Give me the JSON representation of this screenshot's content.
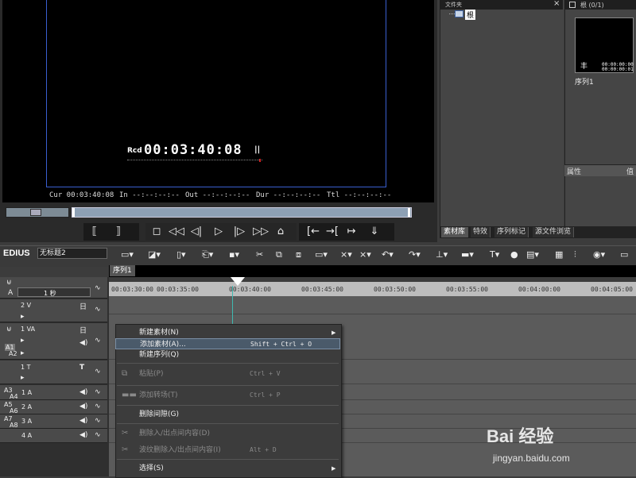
{
  "preview": {
    "rcd_label": "Rcd",
    "record_timecode": "00:03:40:08",
    "pause_indicator": "||",
    "readouts": {
      "cur": "Cur 00:03:40:08",
      "in": "In --:--:--:--",
      "out": "Out --:--:--:--",
      "dur": "Dur --:--:--:--",
      "ttl": "Ttl --:--:--:--"
    }
  },
  "bin": {
    "title": "文件夹",
    "close_icon": "×",
    "root_folder": "根",
    "tabs": [
      "素材库",
      "特效",
      "序列标记",
      "源文件浏览"
    ]
  },
  "clip_panel": {
    "count": "根 (0/1)",
    "thumb_tc_1": "00:00:00:00",
    "thumb_tc_2": "00:00:00:01",
    "thumb_mark": "丰",
    "thumb_label": "序列1",
    "properties_label": "属性",
    "value_label": "值"
  },
  "toolbar": {
    "brand": "EDIUS",
    "project_name": "无标题2"
  },
  "timeline": {
    "sequence_tab": "序列1",
    "zoom_label": "1 秒",
    "ruler_labels": [
      "00:03:30:00",
      "00:03:35:00",
      "00:03:40:00",
      "00:03:45:00",
      "00:03:50:00",
      "00:03:55:00",
      "00:04:00:00",
      "00:04:05:00"
    ],
    "tracks": [
      "2 V",
      "1 VA",
      "1 T",
      "1 A",
      "2 A",
      "3 A",
      "4 A"
    ],
    "side_labels": [
      "A1",
      "A2",
      "A3",
      "A4",
      "A5",
      "A6",
      "A7",
      "A8"
    ]
  },
  "context_menu": {
    "items": [
      {
        "label": "新建素材(N)",
        "shortcut": "",
        "submenu": true,
        "disabled": false,
        "highlight": false
      },
      {
        "label": "添加素材(A)...",
        "shortcut": "Shift + Ctrl + O",
        "submenu": false,
        "disabled": false,
        "highlight": true
      },
      {
        "label": "新建序列(Q)",
        "shortcut": "",
        "submenu": false,
        "disabled": false,
        "highlight": false
      },
      {
        "label": "粘贴(P)",
        "shortcut": "Ctrl + V",
        "submenu": false,
        "disabled": true,
        "highlight": false
      },
      {
        "label": "添加转场(T)",
        "shortcut": "Ctrl + P",
        "submenu": false,
        "disabled": true,
        "highlight": false
      },
      {
        "label": "删除间隙(G)",
        "shortcut": "",
        "submenu": false,
        "disabled": false,
        "highlight": false
      },
      {
        "label": "删除入/出点间内容(D)",
        "shortcut": "",
        "submenu": false,
        "disabled": true,
        "highlight": false
      },
      {
        "label": "波纹删除入/出点间内容(I)",
        "shortcut": "Alt + D",
        "submenu": false,
        "disabled": true,
        "highlight": false
      },
      {
        "label": "选择(S)",
        "shortcut": "",
        "submenu": true,
        "disabled": false,
        "highlight": false
      }
    ]
  },
  "watermark": {
    "text": "Bai 经验",
    "url": "jingyan.baidu.com"
  }
}
